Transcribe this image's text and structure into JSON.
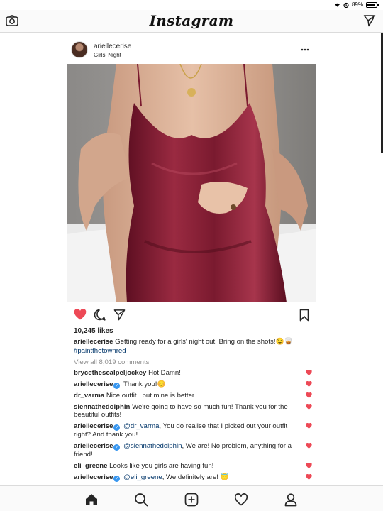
{
  "status": {
    "battery_text": "89%",
    "battery_level": 0.89
  },
  "header": {
    "logo": "Instagram"
  },
  "post": {
    "username": "ariellecerise",
    "location": "Girls' Night",
    "likes": "10,245 likes",
    "caption_user": "ariellecerise",
    "caption_text": "Getting ready for a girls' night out! Bring on the shots!😉🥃",
    "caption_hashtag": "#paintthetownred",
    "view_all": "View all 8,019 comments"
  },
  "comments": [
    {
      "user": "brycethescalpeljockey",
      "verified": false,
      "mention": "",
      "text": "Hot Damn!"
    },
    {
      "user": "ariellecerise",
      "verified": true,
      "mention": "",
      "text": "Thank you!😊"
    },
    {
      "user": "dr_varma",
      "verified": false,
      "mention": "",
      "text": "Nice outfit...but mine is better."
    },
    {
      "user": "siennathedolphin",
      "verified": false,
      "mention": "",
      "text": "We're going to have so much fun! Thank you for the beautiful outfits!"
    },
    {
      "user": "ariellecerise",
      "verified": true,
      "mention": "@dr_varma",
      "text": ", You do realise that I picked out your outfit right? And thank you!"
    },
    {
      "user": "ariellecerise",
      "verified": true,
      "mention": "@siennathedolphin",
      "text": ", We are! No problem, anything for a friend!"
    },
    {
      "user": "eli_greene",
      "verified": false,
      "mention": "",
      "text": "Looks like you girls are having fun!"
    },
    {
      "user": "ariellecerise",
      "verified": true,
      "mention": "@eli_greene",
      "text": ", We definitely are! 😇"
    }
  ],
  "icons": {
    "camera": "camera-icon",
    "direct": "paper-plane-icon",
    "more": "more-options-icon",
    "like": "heart-filled-icon",
    "comment": "comment-bubble-icon",
    "share": "paper-plane-icon",
    "save": "bookmark-icon",
    "home": "home-icon",
    "search": "search-icon",
    "new_post": "plus-square-icon",
    "activity": "heart-outline-icon",
    "profile": "person-icon"
  },
  "colors": {
    "like_red": "#ed4956",
    "mention_blue": "#003569",
    "verified_blue": "#3897f0",
    "dress": "#8a1e34"
  }
}
